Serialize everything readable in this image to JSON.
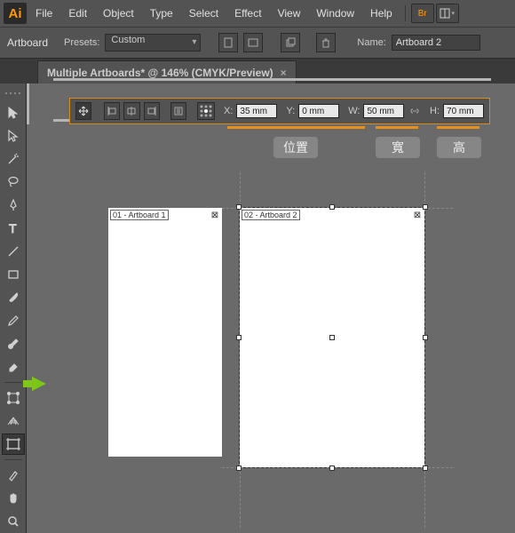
{
  "menu": {
    "items": [
      "File",
      "Edit",
      "Object",
      "Type",
      "Select",
      "Effect",
      "View",
      "Window",
      "Help"
    ],
    "bridge_label": "Br"
  },
  "control": {
    "tool_label": "Artboard",
    "presets_label": "Presets:",
    "presets_value": "Custom",
    "name_label": "Name:",
    "name_value": "Artboard 2"
  },
  "doctab": {
    "title": "Multiple Artboards* @ 146% (CMYK/Preview)"
  },
  "options": {
    "x_label": "X:",
    "x_value": "35 mm",
    "y_label": "Y:",
    "y_value": "0 mm",
    "w_label": "W:",
    "w_value": "50 mm",
    "h_label": "H:",
    "h_value": "70 mm"
  },
  "annotations": {
    "position": "位置",
    "width": "寬",
    "height": "高"
  },
  "artboards": [
    {
      "label": "01 - Artboard 1"
    },
    {
      "label": "02 - Artboard 2"
    }
  ]
}
